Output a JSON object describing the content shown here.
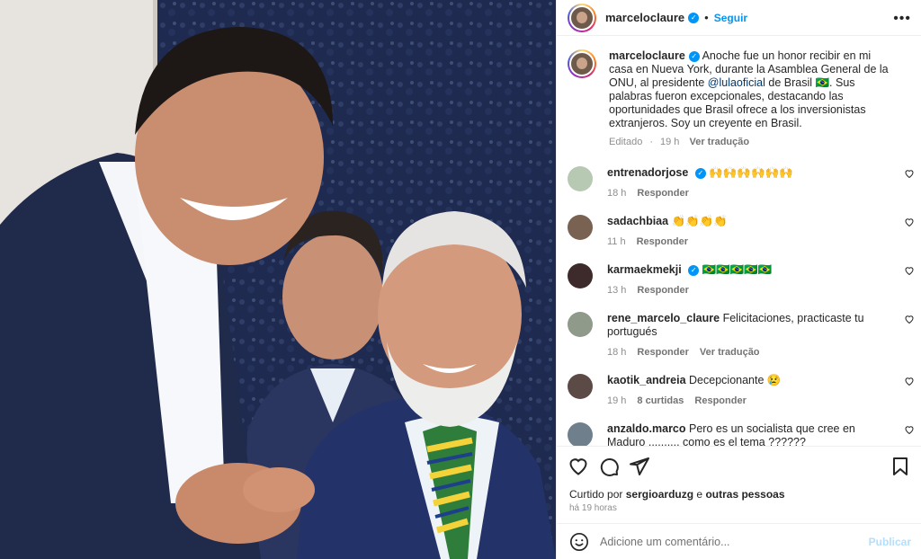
{
  "post": {
    "username": "marceloclaure",
    "follow_label": "Seguir",
    "separator": "•",
    "more_label": "•••"
  },
  "caption": {
    "username": "marceloclaure",
    "text_part1": "Anoche fue un honor recibir en mi casa en Nueva York, durante la Asamblea General de la ONU, al presidente ",
    "mention": "@lulaoficial",
    "text_part2": " de Brasil 🇧🇷. Sus palabras fueron excepcionales, destacando las oportunidades que Brasil ofrece a los inversionistas extranjeros. Soy un creyente en Brasil.",
    "edited": "Editado",
    "time": "19 h",
    "translate": "Ver tradução"
  },
  "comments": [
    {
      "username": "entrenadorjose",
      "verified": true,
      "text": "🙌🙌🙌🙌🙌🙌",
      "time": "18 h",
      "likes": "",
      "reply": "Responder",
      "translate": "",
      "avatar_color": "#b7c9b2"
    },
    {
      "username": "sadachbiaa",
      "verified": false,
      "text": "👏👏👏👏",
      "time": "11 h",
      "likes": "",
      "reply": "Responder",
      "translate": "",
      "avatar_color": "#7a6252"
    },
    {
      "username": "karmaekmekji",
      "verified": true,
      "text": "🇧🇷🇧🇷🇧🇷🇧🇷🇧🇷",
      "time": "13 h",
      "likes": "",
      "reply": "Responder",
      "translate": "",
      "avatar_color": "#3d2a2a"
    },
    {
      "username": "rene_marcelo_claure",
      "verified": false,
      "text": "Felicitaciones, practicaste tu portugués",
      "time": "18 h",
      "likes": "",
      "reply": "Responder",
      "translate": "Ver tradução",
      "avatar_color": "#8f9a8a"
    },
    {
      "username": "kaotik_andreia",
      "verified": false,
      "text": "Decepcionante 😢",
      "time": "19 h",
      "likes": "8 curtidas",
      "reply": "Responder",
      "translate": "",
      "avatar_color": "#5b4a45"
    },
    {
      "username": "anzaldo.marco",
      "verified": false,
      "text": "Pero es un socialista que cree en Maduro .......... como es el tema ??????",
      "time": "",
      "likes": "",
      "reply": "",
      "translate": "",
      "avatar_color": "#6f7f8c"
    }
  ],
  "likes": {
    "prefix": "Curtido por",
    "user": "sergioarduzg",
    "middle": "e",
    "others": "outras pessoas"
  },
  "timestamp": "há 19 horas",
  "comment_box": {
    "placeholder": "Adicione um comentário...",
    "publish_label": "Publicar"
  },
  "colors": {
    "accent": "#0095f6",
    "muted": "#8e8e8e",
    "publish_disabled": "#b2dffc"
  }
}
